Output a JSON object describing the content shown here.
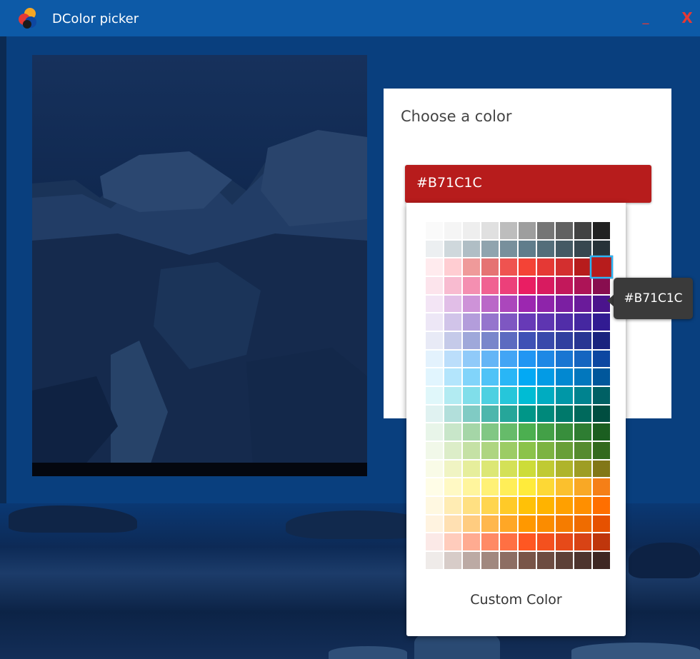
{
  "window": {
    "title": "DColor picker",
    "minimize_label": "_",
    "close_label": "X",
    "titlebar_color": "#0d5aa7",
    "close_color": "#e53935"
  },
  "icons": {
    "app_logo": "palette-logo-icon",
    "minimize": "minimize-icon",
    "close": "close-icon"
  },
  "card": {
    "title": "Choose a color",
    "selected_color_value": "#B71C1C"
  },
  "picker": {
    "custom_color_label": "Custom Color",
    "selected_hex": "#B71C1C",
    "tooltip": "#B71C1C",
    "swatch_rows": [
      [
        "#FAFAFA",
        "#F5F5F5",
        "#EEEEEE",
        "#E0E0E0",
        "#BDBDBD",
        "#9E9E9E",
        "#757575",
        "#616161",
        "#424242",
        "#212121"
      ],
      [
        "#ECEFF1",
        "#CFD8DC",
        "#B0BEC5",
        "#90A4AE",
        "#78909C",
        "#607D8B",
        "#546E7A",
        "#455A64",
        "#37474F",
        "#263238"
      ],
      [
        "#FFEBEE",
        "#FFCDD2",
        "#EF9A9A",
        "#E57373",
        "#EF5350",
        "#F44336",
        "#E53935",
        "#D32F2F",
        "#B71C1C",
        "#B71C1C"
      ],
      [
        "#FCE4EC",
        "#F8BBD0",
        "#F48FB1",
        "#F06292",
        "#EC407A",
        "#E91E63",
        "#D81B60",
        "#C2185B",
        "#AD1457",
        "#880E4F"
      ],
      [
        "#F3E5F5",
        "#E1BEE7",
        "#CE93D8",
        "#BA68C8",
        "#AB47BC",
        "#9C27B0",
        "#8E24AA",
        "#7B1FA2",
        "#6A1B9A",
        "#4A148C"
      ],
      [
        "#EDE7F6",
        "#D1C4E9",
        "#B39DDB",
        "#9575CD",
        "#7E57C2",
        "#673AB7",
        "#5E35B1",
        "#512DA8",
        "#4527A0",
        "#311B92"
      ],
      [
        "#E8EAF6",
        "#C5CAE9",
        "#9FA8DA",
        "#7986CB",
        "#5C6BC0",
        "#3F51B5",
        "#3949AB",
        "#303F9F",
        "#283593",
        "#1A237E"
      ],
      [
        "#E3F2FD",
        "#BBDEFB",
        "#90CAF9",
        "#64B5F6",
        "#42A5F5",
        "#2196F3",
        "#1E88E5",
        "#1976D2",
        "#1565C0",
        "#0D47A1"
      ],
      [
        "#E1F5FE",
        "#B3E5FC",
        "#81D4FA",
        "#4FC3F7",
        "#29B6F6",
        "#03A9F4",
        "#039BE5",
        "#0288D1",
        "#0277BD",
        "#01579B"
      ],
      [
        "#E0F7FA",
        "#B2EBF2",
        "#80DEEA",
        "#4DD0E1",
        "#26C6DA",
        "#00BCD4",
        "#00ACC1",
        "#0097A7",
        "#00838F",
        "#006064"
      ],
      [
        "#E0F2F1",
        "#B2DFDB",
        "#80CBC4",
        "#4DB6AC",
        "#26A69A",
        "#009688",
        "#00897B",
        "#00796B",
        "#00695C",
        "#004D40"
      ],
      [
        "#E8F5E9",
        "#C8E6C9",
        "#A5D6A7",
        "#81C784",
        "#66BB6A",
        "#4CAF50",
        "#43A047",
        "#388E3C",
        "#2E7D32",
        "#1B5E20"
      ],
      [
        "#F1F8E9",
        "#DCEDC8",
        "#C5E1A5",
        "#AED581",
        "#9CCC65",
        "#8BC34A",
        "#7CB342",
        "#689F38",
        "#558B2F",
        "#33691E"
      ],
      [
        "#F9FBE7",
        "#F0F4C3",
        "#E6EE9C",
        "#DCE775",
        "#D4E157",
        "#CDDC39",
        "#C0CA33",
        "#AFB42B",
        "#9E9D24",
        "#827717"
      ],
      [
        "#FFFDE7",
        "#FFF9C4",
        "#FFF59D",
        "#FFF176",
        "#FFEE58",
        "#FFEB3B",
        "#FDD835",
        "#FBC02D",
        "#F9A825",
        "#F57F17"
      ],
      [
        "#FFF8E1",
        "#FFECB3",
        "#FFE082",
        "#FFD54F",
        "#FFCA28",
        "#FFC107",
        "#FFB300",
        "#FFA000",
        "#FF8F00",
        "#FF6F00"
      ],
      [
        "#FFF3E0",
        "#FFE0B2",
        "#FFCC80",
        "#FFB74D",
        "#FFA726",
        "#FF9800",
        "#FB8C00",
        "#F57C00",
        "#EF6C00",
        "#E65100"
      ],
      [
        "#FBE9E7",
        "#FFCCBC",
        "#FFAB91",
        "#FF8A65",
        "#FF7043",
        "#FF5722",
        "#F4511E",
        "#E64A19",
        "#D84315",
        "#BF360C"
      ],
      [
        "#EFEBE9",
        "#D7CCC8",
        "#BCAAA4",
        "#A1887F",
        "#8D6E63",
        "#795548",
        "#6D4C41",
        "#5D4037",
        "#4E342E",
        "#3E2723"
      ]
    ]
  }
}
